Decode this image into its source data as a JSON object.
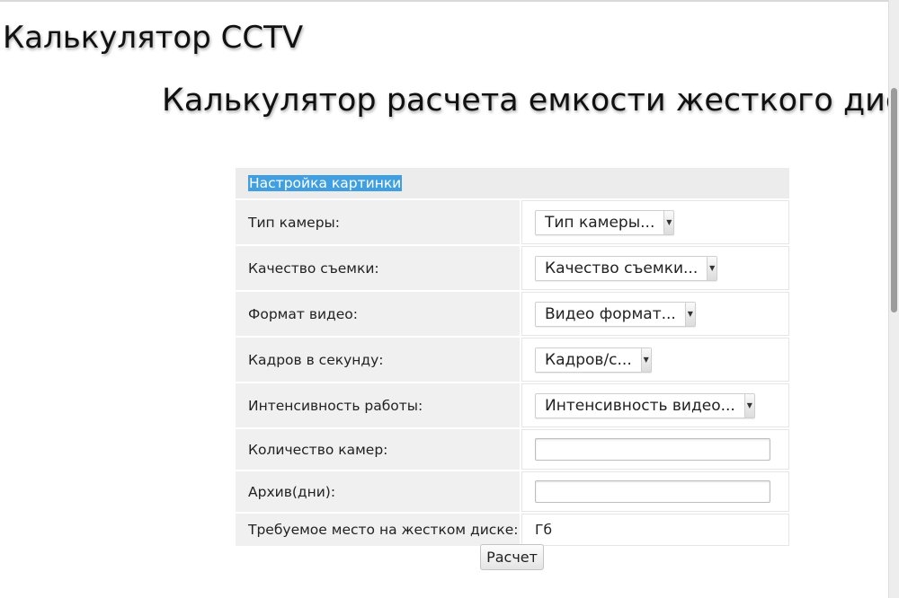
{
  "site_title": "Калькулятор CCTV",
  "page_heading": "Калькулятор расчета емкости жесткого диска",
  "section": {
    "title": "Настройка картинки"
  },
  "fields": {
    "camera_type": {
      "label": "Тип камеры:",
      "value": "Тип камеры..."
    },
    "quality": {
      "label": "Качество съемки:",
      "value": "Качество съемки..."
    },
    "video_format": {
      "label": "Формат видео:",
      "value": "Видео формат..."
    },
    "fps": {
      "label": "Кадров в секунду:",
      "value": "Кадров/с..."
    },
    "intensity": {
      "label": "Интенсивность работы:",
      "value": "Интенсивность видео..."
    },
    "camera_count": {
      "label": "Количество камер:",
      "value": ""
    },
    "archive_days": {
      "label": "Архив(дни):",
      "value": ""
    },
    "required_space": {
      "label": "Требуемое место на жестком диске:",
      "value": "Гб"
    }
  },
  "calc_button": {
    "label": "Расчет"
  },
  "colors": {
    "selection": "#3f9fe0",
    "label_bg": "#f0f0f0",
    "header_bg": "#ececec"
  },
  "icons": {
    "dropdown": "chevron-down-icon"
  }
}
